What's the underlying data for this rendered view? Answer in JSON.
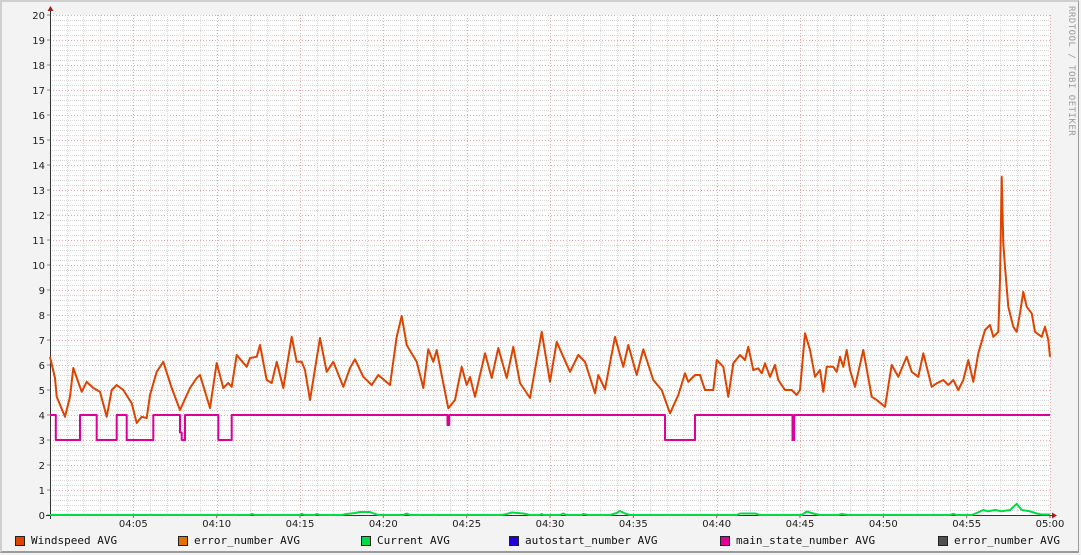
{
  "watermark": "RRDTOOL / TOBI OETIKER",
  "chart_data": {
    "type": "line",
    "title": "",
    "xlabel": "",
    "ylabel": "",
    "xlim_minutes": [
      0,
      60
    ],
    "ylim": [
      0,
      20
    ],
    "grid": true,
    "legend_position": "bottom",
    "y_ticks": [
      "0",
      "1",
      "2",
      "3",
      "4",
      "5",
      "6",
      "7",
      "8",
      "9",
      "10",
      "11",
      "12",
      "13",
      "14",
      "15",
      "16",
      "17",
      "18",
      "19",
      "20"
    ],
    "x_ticks": [
      {
        "minute": 5,
        "label": "04:05"
      },
      {
        "minute": 10,
        "label": "04:10"
      },
      {
        "minute": 15,
        "label": "04:15"
      },
      {
        "minute": 20,
        "label": "04:20"
      },
      {
        "minute": 25,
        "label": "04:25"
      },
      {
        "minute": 30,
        "label": "04:30"
      },
      {
        "minute": 35,
        "label": "04:35"
      },
      {
        "minute": 40,
        "label": "04:40"
      },
      {
        "minute": 45,
        "label": "04:45"
      },
      {
        "minute": 50,
        "label": "04:50"
      },
      {
        "minute": 55,
        "label": "04:55"
      },
      {
        "minute": 60,
        "label": "05:00"
      }
    ],
    "series": [
      {
        "name": "Windspeed AVG",
        "color": "#dd4400",
        "step": false,
        "points": [
          [
            0,
            6.33
          ],
          [
            0.3,
            5.48
          ],
          [
            0.4,
            4.73
          ],
          [
            0.9,
            3.93
          ],
          [
            1.2,
            4.73
          ],
          [
            1.4,
            5.88
          ],
          [
            1.9,
            4.93
          ],
          [
            2.2,
            5.33
          ],
          [
            2.6,
            5.08
          ],
          [
            3.0,
            4.93
          ],
          [
            3.4,
            3.93
          ],
          [
            3.7,
            5.0
          ],
          [
            4.0,
            5.2
          ],
          [
            4.4,
            5.0
          ],
          [
            4.9,
            4.47
          ],
          [
            5.2,
            3.68
          ],
          [
            5.5,
            3.93
          ],
          [
            5.8,
            3.88
          ],
          [
            6.0,
            4.8
          ],
          [
            6.4,
            5.73
          ],
          [
            6.8,
            6.13
          ],
          [
            7.3,
            5.08
          ],
          [
            7.8,
            4.2
          ],
          [
            8.4,
            5.08
          ],
          [
            8.8,
            5.48
          ],
          [
            9.0,
            5.6
          ],
          [
            9.6,
            4.28
          ],
          [
            10.0,
            6.08
          ],
          [
            10.4,
            5.08
          ],
          [
            10.7,
            5.28
          ],
          [
            10.9,
            5.13
          ],
          [
            11.2,
            6.4
          ],
          [
            11.8,
            5.93
          ],
          [
            12.0,
            6.28
          ],
          [
            12.4,
            6.33
          ],
          [
            12.6,
            6.8
          ],
          [
            13.0,
            5.4
          ],
          [
            13.3,
            5.28
          ],
          [
            13.6,
            6.13
          ],
          [
            14.0,
            5.08
          ],
          [
            14.5,
            7.13
          ],
          [
            14.8,
            6.13
          ],
          [
            15.1,
            6.13
          ],
          [
            15.3,
            5.8
          ],
          [
            15.6,
            4.6
          ],
          [
            16.2,
            7.08
          ],
          [
            16.6,
            5.73
          ],
          [
            17.0,
            6.13
          ],
          [
            17.6,
            5.13
          ],
          [
            18.0,
            5.88
          ],
          [
            18.3,
            6.23
          ],
          [
            18.8,
            5.53
          ],
          [
            19.3,
            5.2
          ],
          [
            19.7,
            5.6
          ],
          [
            20.4,
            5.2
          ],
          [
            20.8,
            7.13
          ],
          [
            21.1,
            7.96
          ],
          [
            21.4,
            6.8
          ],
          [
            22.0,
            6.13
          ],
          [
            22.4,
            5.08
          ],
          [
            22.7,
            6.63
          ],
          [
            23.0,
            6.13
          ],
          [
            23.2,
            6.6
          ],
          [
            23.9,
            4.27
          ],
          [
            24.3,
            4.6
          ],
          [
            24.7,
            5.93
          ],
          [
            25.0,
            5.2
          ],
          [
            25.2,
            5.52
          ],
          [
            25.5,
            4.73
          ],
          [
            26.1,
            6.47
          ],
          [
            26.5,
            5.48
          ],
          [
            26.9,
            6.68
          ],
          [
            27.4,
            5.48
          ],
          [
            27.8,
            6.73
          ],
          [
            28.2,
            5.28
          ],
          [
            28.8,
            4.68
          ],
          [
            29.5,
            7.33
          ],
          [
            30.0,
            5.33
          ],
          [
            30.4,
            6.93
          ],
          [
            30.8,
            6.33
          ],
          [
            31.2,
            5.73
          ],
          [
            31.7,
            6.4
          ],
          [
            32.1,
            6.13
          ],
          [
            32.7,
            4.87
          ],
          [
            32.9,
            5.6
          ],
          [
            33.3,
            5.03
          ],
          [
            33.9,
            7.13
          ],
          [
            34.4,
            5.93
          ],
          [
            34.7,
            6.8
          ],
          [
            35.2,
            5.6
          ],
          [
            35.6,
            6.63
          ],
          [
            36.2,
            5.4
          ],
          [
            36.7,
            5.0
          ],
          [
            37.2,
            4.07
          ],
          [
            37.7,
            4.8
          ],
          [
            38.1,
            5.67
          ],
          [
            38.3,
            5.33
          ],
          [
            38.7,
            5.6
          ],
          [
            39.0,
            5.6
          ],
          [
            39.3,
            5.0
          ],
          [
            39.8,
            5.0
          ],
          [
            40.0,
            6.2
          ],
          [
            40.4,
            5.93
          ],
          [
            40.7,
            4.73
          ],
          [
            41.0,
            6.07
          ],
          [
            41.4,
            6.4
          ],
          [
            41.7,
            6.2
          ],
          [
            41.9,
            6.73
          ],
          [
            42.2,
            5.8
          ],
          [
            42.5,
            5.87
          ],
          [
            42.7,
            5.67
          ],
          [
            42.9,
            6.07
          ],
          [
            43.2,
            5.53
          ],
          [
            43.5,
            6.0
          ],
          [
            43.7,
            5.4
          ],
          [
            44.1,
            5.0
          ],
          [
            44.5,
            5.0
          ],
          [
            44.8,
            4.8
          ],
          [
            45.0,
            5.0
          ],
          [
            45.3,
            7.27
          ],
          [
            45.6,
            6.6
          ],
          [
            45.9,
            5.53
          ],
          [
            46.2,
            5.8
          ],
          [
            46.4,
            4.93
          ],
          [
            46.6,
            5.93
          ],
          [
            47.0,
            5.93
          ],
          [
            47.2,
            5.73
          ],
          [
            47.4,
            6.33
          ],
          [
            47.6,
            5.93
          ],
          [
            47.8,
            6.6
          ],
          [
            48.0,
            5.8
          ],
          [
            48.3,
            5.13
          ],
          [
            48.8,
            6.6
          ],
          [
            49.3,
            4.73
          ],
          [
            49.6,
            4.6
          ],
          [
            50.1,
            4.33
          ],
          [
            50.5,
            6.0
          ],
          [
            50.9,
            5.53
          ],
          [
            51.4,
            6.33
          ],
          [
            51.7,
            5.73
          ],
          [
            52.1,
            5.53
          ],
          [
            52.4,
            6.47
          ],
          [
            52.9,
            5.13
          ],
          [
            53.2,
            5.27
          ],
          [
            53.6,
            5.4
          ],
          [
            53.9,
            5.2
          ],
          [
            54.2,
            5.4
          ],
          [
            54.5,
            5.0
          ],
          [
            54.8,
            5.4
          ],
          [
            55.1,
            6.2
          ],
          [
            55.4,
            5.33
          ],
          [
            55.7,
            6.47
          ],
          [
            56.1,
            7.4
          ],
          [
            56.4,
            7.6
          ],
          [
            56.6,
            7.13
          ],
          [
            56.9,
            7.33
          ],
          [
            57.0,
            9.4
          ],
          [
            57.1,
            13.53
          ],
          [
            57.2,
            10.87
          ],
          [
            57.3,
            9.93
          ],
          [
            57.5,
            8.33
          ],
          [
            57.8,
            7.53
          ],
          [
            58.0,
            7.33
          ],
          [
            58.2,
            8.07
          ],
          [
            58.4,
            8.93
          ],
          [
            58.6,
            8.33
          ],
          [
            58.9,
            8.07
          ],
          [
            59.1,
            7.33
          ],
          [
            59.5,
            7.13
          ],
          [
            59.7,
            7.53
          ],
          [
            59.9,
            7.0
          ],
          [
            60.0,
            6.33
          ]
        ]
      },
      {
        "name": "error_number AVG",
        "color": "#e07000",
        "step": true,
        "points": []
      },
      {
        "name": "Current AVG",
        "color": "#00dd44",
        "step": false,
        "points": [
          [
            0,
            0
          ],
          [
            12,
            0
          ],
          [
            12.1,
            0.04
          ],
          [
            12.3,
            0
          ],
          [
            15.0,
            0
          ],
          [
            15.1,
            0.04
          ],
          [
            15.3,
            0
          ],
          [
            15.9,
            0
          ],
          [
            16.0,
            0.04
          ],
          [
            16.2,
            0
          ],
          [
            17.5,
            0
          ],
          [
            17.8,
            0.04
          ],
          [
            18.3,
            0.08
          ],
          [
            18.6,
            0.12
          ],
          [
            19.2,
            0.12
          ],
          [
            19.5,
            0.04
          ],
          [
            19.7,
            0
          ],
          [
            21.2,
            0
          ],
          [
            21.4,
            0.06
          ],
          [
            21.6,
            0
          ],
          [
            27.1,
            0
          ],
          [
            27.4,
            0.04
          ],
          [
            27.7,
            0.1
          ],
          [
            28.4,
            0.06
          ],
          [
            28.8,
            0
          ],
          [
            29.4,
            0
          ],
          [
            29.5,
            0.04
          ],
          [
            29.6,
            0
          ],
          [
            30.6,
            0
          ],
          [
            30.8,
            0.06
          ],
          [
            31.0,
            0
          ],
          [
            31.9,
            0
          ],
          [
            32.0,
            0.04
          ],
          [
            32.3,
            0
          ],
          [
            33.6,
            0
          ],
          [
            34.0,
            0.08
          ],
          [
            34.2,
            0.16
          ],
          [
            34.5,
            0.06
          ],
          [
            34.8,
            0
          ],
          [
            41.2,
            0
          ],
          [
            41.4,
            0.06
          ],
          [
            42.3,
            0.06
          ],
          [
            42.6,
            0
          ],
          [
            45.1,
            0
          ],
          [
            45.4,
            0.14
          ],
          [
            45.9,
            0.04
          ],
          [
            46.2,
            0
          ],
          [
            47.3,
            0
          ],
          [
            47.5,
            0.04
          ],
          [
            47.9,
            0
          ],
          [
            54.0,
            0
          ],
          [
            54.2,
            0.04
          ],
          [
            54.4,
            0
          ],
          [
            55.3,
            0
          ],
          [
            55.6,
            0.08
          ],
          [
            56.0,
            0.2
          ],
          [
            56.3,
            0.15
          ],
          [
            56.7,
            0.2
          ],
          [
            57.1,
            0.15
          ],
          [
            57.6,
            0.2
          ],
          [
            58.0,
            0.45
          ],
          [
            58.3,
            0.2
          ],
          [
            58.8,
            0.15
          ],
          [
            59.2,
            0.06
          ],
          [
            59.5,
            0.02
          ],
          [
            60,
            0.02
          ]
        ]
      },
      {
        "name": "autostart_number AVG",
        "color": "#2200dd",
        "step": true,
        "points": []
      },
      {
        "name": "main_state_number AVG",
        "color": "#dd0099",
        "step": true,
        "points": [
          [
            0,
            4
          ],
          [
            0.35,
            3
          ],
          [
            1.8,
            4
          ],
          [
            2.8,
            3
          ],
          [
            4.0,
            4
          ],
          [
            4.6,
            3
          ],
          [
            6.2,
            4
          ],
          [
            7.8,
            3.3
          ],
          [
            7.9,
            3
          ],
          [
            8.1,
            4
          ],
          [
            10.1,
            3
          ],
          [
            10.9,
            4
          ],
          [
            23.85,
            3.6
          ],
          [
            23.95,
            4
          ],
          [
            36.9,
            3
          ],
          [
            38.7,
            4
          ],
          [
            44.55,
            3
          ],
          [
            44.65,
            4
          ],
          [
            60,
            4
          ]
        ]
      },
      {
        "name": "error_number AVG",
        "color": "#505050",
        "step": true,
        "points": []
      }
    ]
  }
}
